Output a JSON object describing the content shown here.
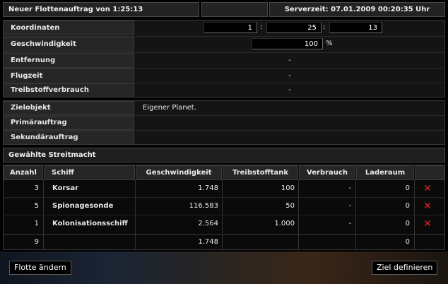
{
  "header": {
    "title": "Neuer Flottenauftrag von 1:25:13",
    "server_time": "Serverzeit: 07.01.2009 00:20:35 Uhr"
  },
  "target": {
    "coords_label": "Koordinaten",
    "galaxy": "1",
    "system": "25",
    "planet": "13",
    "separator": ":",
    "speed_label": "Geschwindigkeit",
    "speed_value": "100",
    "speed_unit": "%",
    "distance_label": "Entfernung",
    "distance_value": "-",
    "flight_time_label": "Flugzeit",
    "flight_time_value": "-",
    "fuel_label": "Treibstoffverbrauch",
    "fuel_value": "-"
  },
  "mission": {
    "target_object_label": "Zielobjekt",
    "target_object_value": "Eigener Planet.",
    "primary_label": "Primärauftrag",
    "secondary_label": "Sekundärauftrag"
  },
  "fleet": {
    "title": "Gewählte Streitmacht",
    "columns": [
      "Anzahl",
      "Schiff",
      "Geschwindigkeit",
      "Treibstofftank",
      "Verbrauch",
      "Laderaum"
    ],
    "rows": [
      {
        "count": "3",
        "ship": "Korsar",
        "speed": "1.748",
        "tank": "100",
        "consumption": "-",
        "cargo": "0"
      },
      {
        "count": "5",
        "ship": "Spionagesonde",
        "speed": "116.583",
        "tank": "50",
        "consumption": "-",
        "cargo": "0"
      },
      {
        "count": "1",
        "ship": "Kolonisationsschiff",
        "speed": "2.564",
        "tank": "1.000",
        "consumption": "-",
        "cargo": "0"
      }
    ],
    "totals": {
      "count": "9",
      "speed": "1.748",
      "cargo": "0"
    },
    "remove_glyph": "✕"
  },
  "buttons": {
    "change_fleet": "Flotte ändern",
    "define_target": "Ziel definieren"
  },
  "colors": {
    "remove": "#e02020",
    "panel": "#262626",
    "background": "#000000"
  }
}
